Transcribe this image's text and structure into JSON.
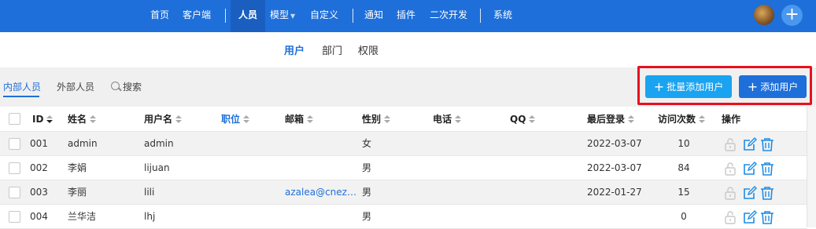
{
  "nav": {
    "items": [
      "首页",
      "客户端",
      "人员",
      "模型",
      "自定义",
      "通知",
      "插件",
      "二次开发",
      "系统"
    ],
    "active": "人员"
  },
  "subtabs": [
    "用户",
    "部门",
    "权限"
  ],
  "toolbar": {
    "tab_internal": "内部人员",
    "tab_external": "外部人员",
    "search_label": "搜索",
    "batch_add_label": "批量添加用户",
    "add_label": "添加用户"
  },
  "table": {
    "headers": {
      "id": "ID",
      "name": "姓名",
      "username": "用户名",
      "position": "职位",
      "email": "邮箱",
      "gender": "性别",
      "phone": "电话",
      "qq": "QQ",
      "last_login": "最后登录",
      "visits": "访问次数",
      "ops": "操作"
    },
    "rows": [
      {
        "id": "001",
        "name": "admin",
        "username": "admin",
        "email": "",
        "gender": "女",
        "last_login": "2022-03-07",
        "visits": "10"
      },
      {
        "id": "002",
        "name": "李娟",
        "username": "lijuan",
        "email": "",
        "gender": "男",
        "last_login": "2022-03-07",
        "visits": "84"
      },
      {
        "id": "003",
        "name": "李丽",
        "username": "lili",
        "email": "azalea@cnez…",
        "gender": "男",
        "last_login": "2022-01-27",
        "visits": "15"
      },
      {
        "id": "004",
        "name": "兰华洁",
        "username": "lhj",
        "email": "",
        "gender": "男",
        "last_login": "",
        "visits": "0"
      }
    ]
  },
  "colors": {
    "primary": "#1e6fd9",
    "secondary_button": "#1aa3f0",
    "highlight": "#e8101d"
  }
}
